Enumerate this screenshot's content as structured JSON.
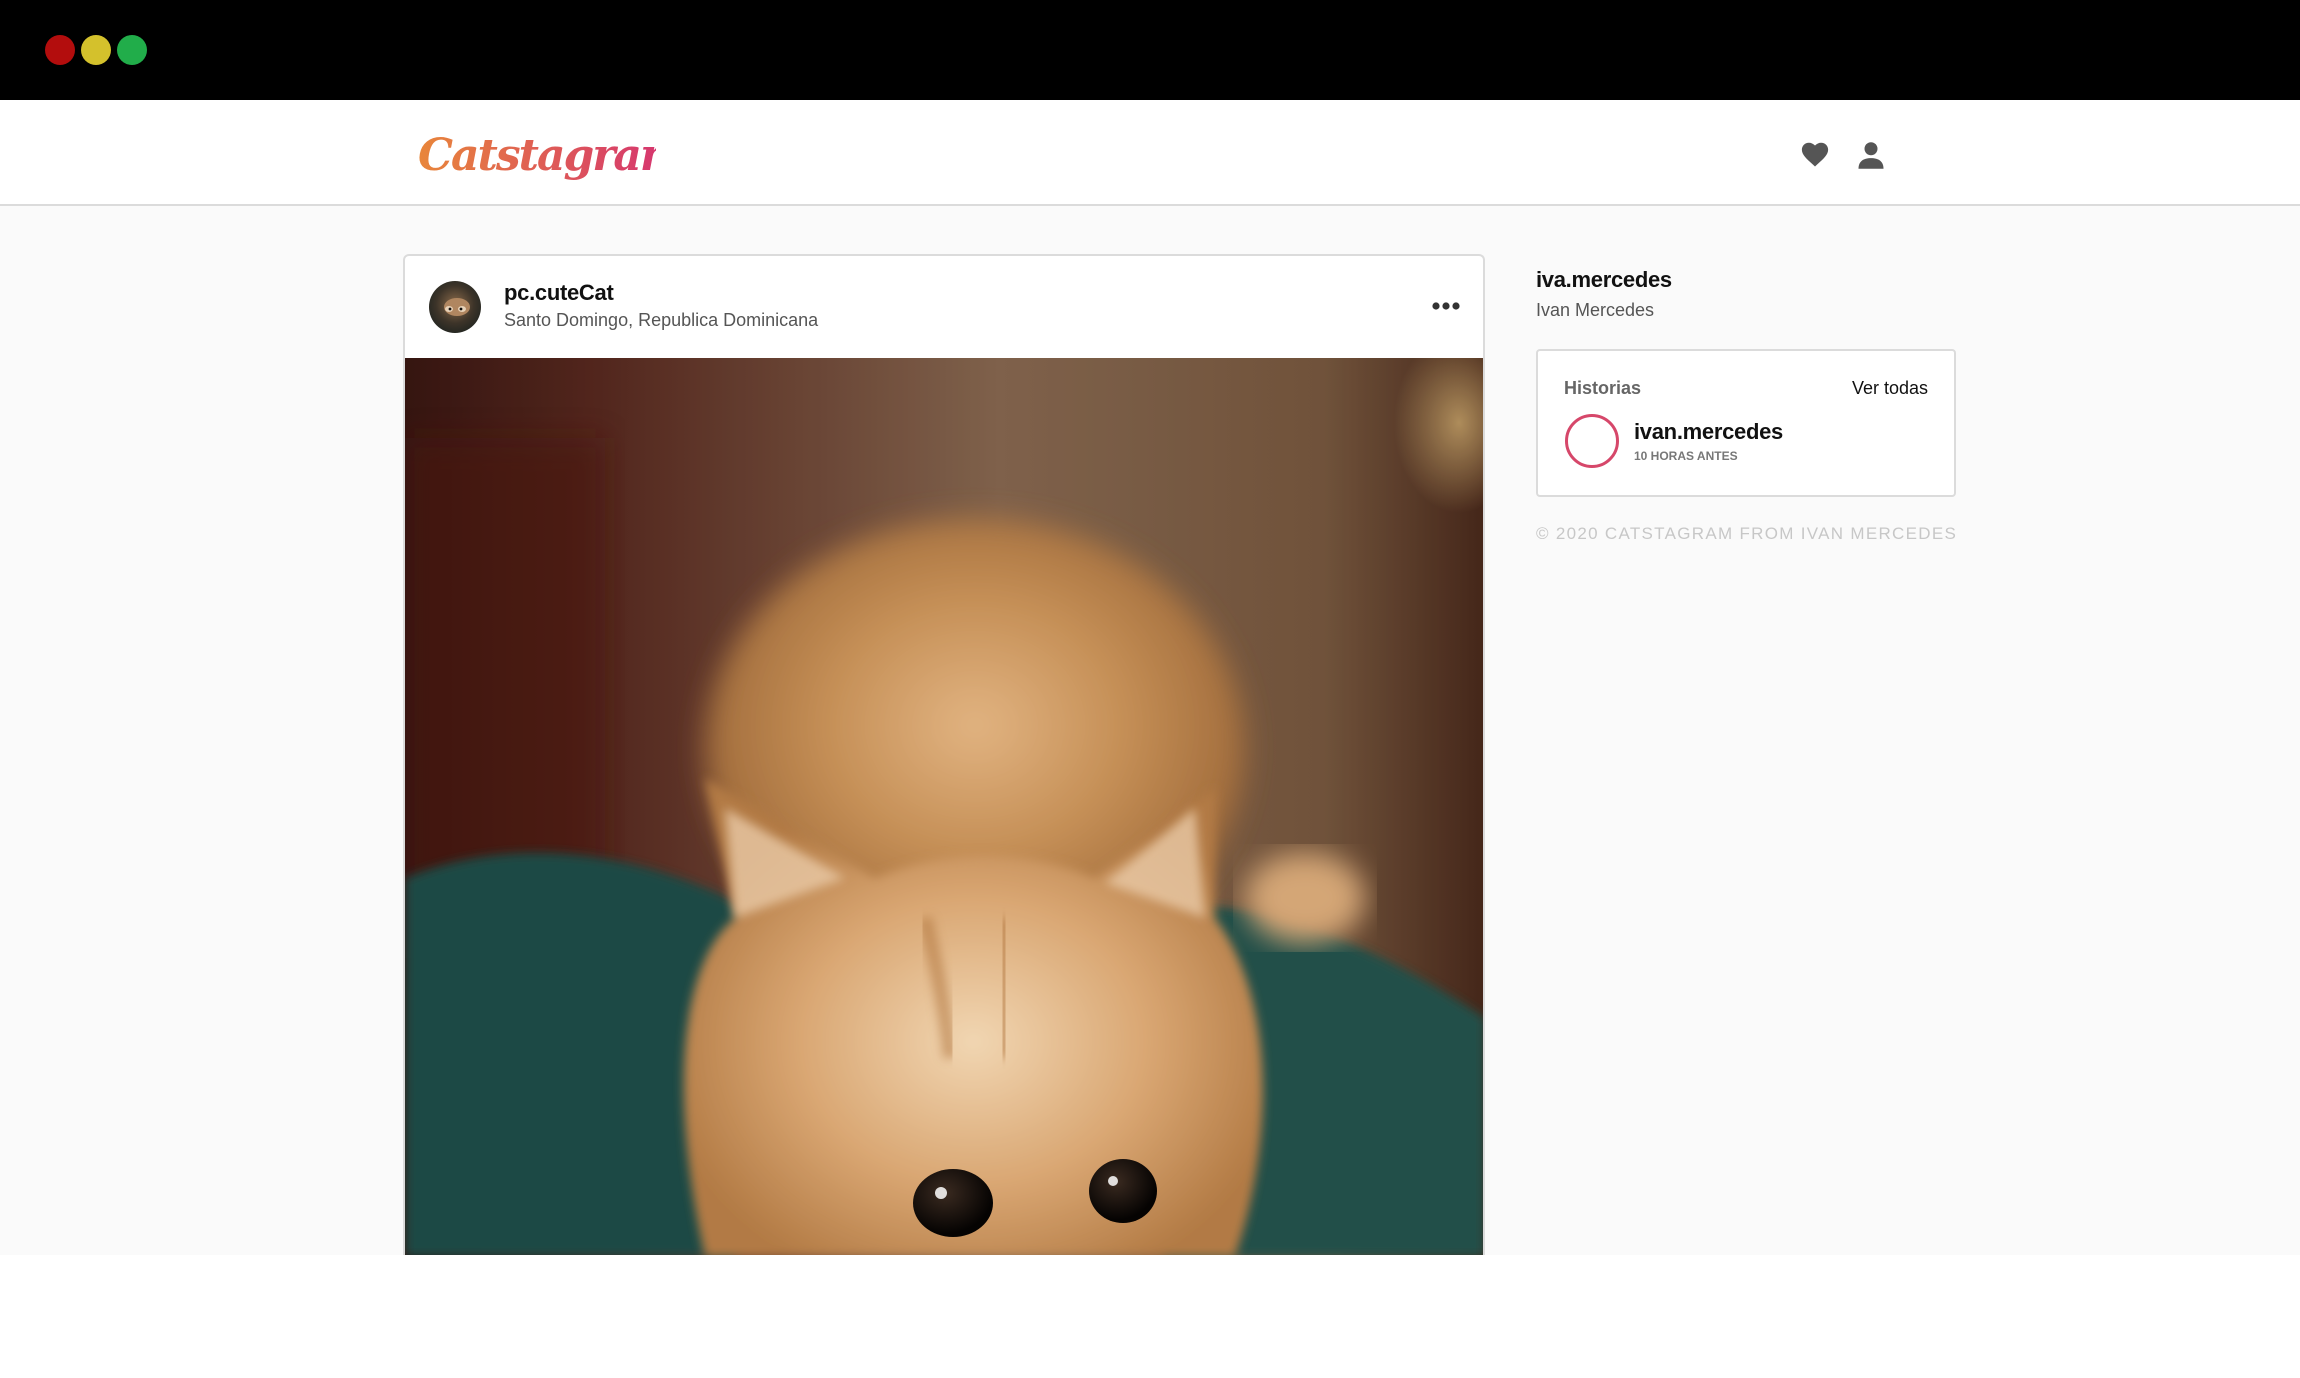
{
  "window": {
    "controls": [
      "close",
      "minimize",
      "maximize"
    ]
  },
  "header": {
    "logo_text": "Catstagram",
    "icons": [
      "heart-icon",
      "user-icon"
    ]
  },
  "post": {
    "username": "pc.cuteCat",
    "location": "Santo Domingo, Republica Dominicana",
    "menu_icon": "more-options-icon"
  },
  "profile": {
    "username": "iva.mercedes",
    "full_name": "Ivan Mercedes"
  },
  "stories": {
    "title": "Historias",
    "view_all": "Ver todas",
    "items": [
      {
        "username": "ivan.mercedes",
        "time": "10 HORAS ANTES"
      }
    ]
  },
  "footer": {
    "text": "© 2020 CATSTAGRAM FROM IVAN MERCEDES"
  },
  "colors": {
    "background": "#fafafa",
    "border": "#dbdbdb",
    "story_ring": "#d6476a",
    "logo_gradient": [
      "#e8863a",
      "#d42e74"
    ]
  }
}
